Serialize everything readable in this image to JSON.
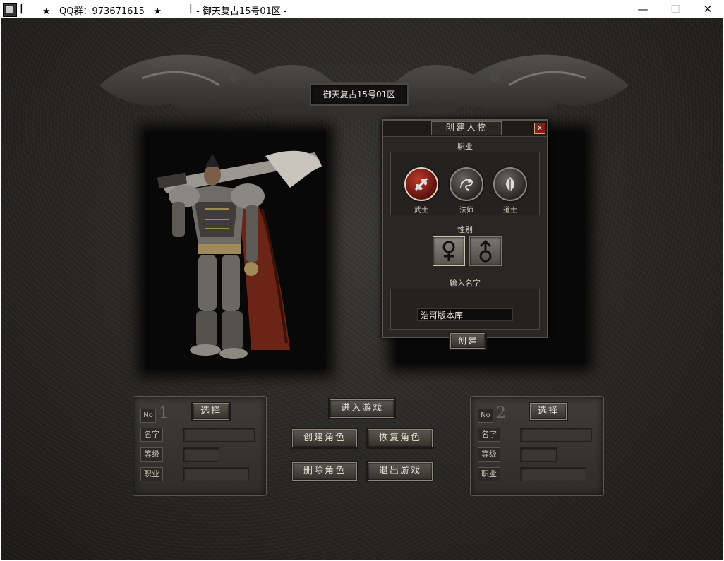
{
  "window": {
    "title_left": "★   QQ群：973671615   ★",
    "title_right": "- 御天复古15号01区 -",
    "minimize_label": "—",
    "maximize_label": "☐",
    "close_label": "✕"
  },
  "server_name": "御天复古15号01区",
  "create_dialog": {
    "title": "创建人物",
    "close_label": "x",
    "class_label": "职业",
    "classes": [
      {
        "label": "武士",
        "icon": "warrior-axe-icon",
        "selected": true
      },
      {
        "label": "法师",
        "icon": "mage-dragon-icon",
        "selected": false
      },
      {
        "label": "道士",
        "icon": "taoist-feather-icon",
        "selected": false
      }
    ],
    "gender_label": "性别",
    "genders": [
      {
        "icon": "female-symbol-icon",
        "selected": true
      },
      {
        "icon": "male-symbol-icon",
        "selected": false
      }
    ],
    "name_label": "输入名字",
    "name_value": "浩哥版本库",
    "create_label": "创建"
  },
  "buttons": {
    "enter_game": "进入游戏",
    "create_role": "创建角色",
    "restore_role": "恢复角色",
    "delete_role": "删除角色",
    "exit_game": "退出游戏"
  },
  "slots": [
    {
      "no_label": "No",
      "number": "1",
      "select_label": "选择",
      "name_label": "名字",
      "level_label": "等级",
      "class_label": "职业",
      "name_value": "",
      "level_value": "",
      "class_value": ""
    },
    {
      "no_label": "No",
      "number": "2",
      "select_label": "选择",
      "name_label": "名字",
      "level_label": "等级",
      "class_label": "职业",
      "name_value": "",
      "level_value": "",
      "class_value": ""
    }
  ]
}
